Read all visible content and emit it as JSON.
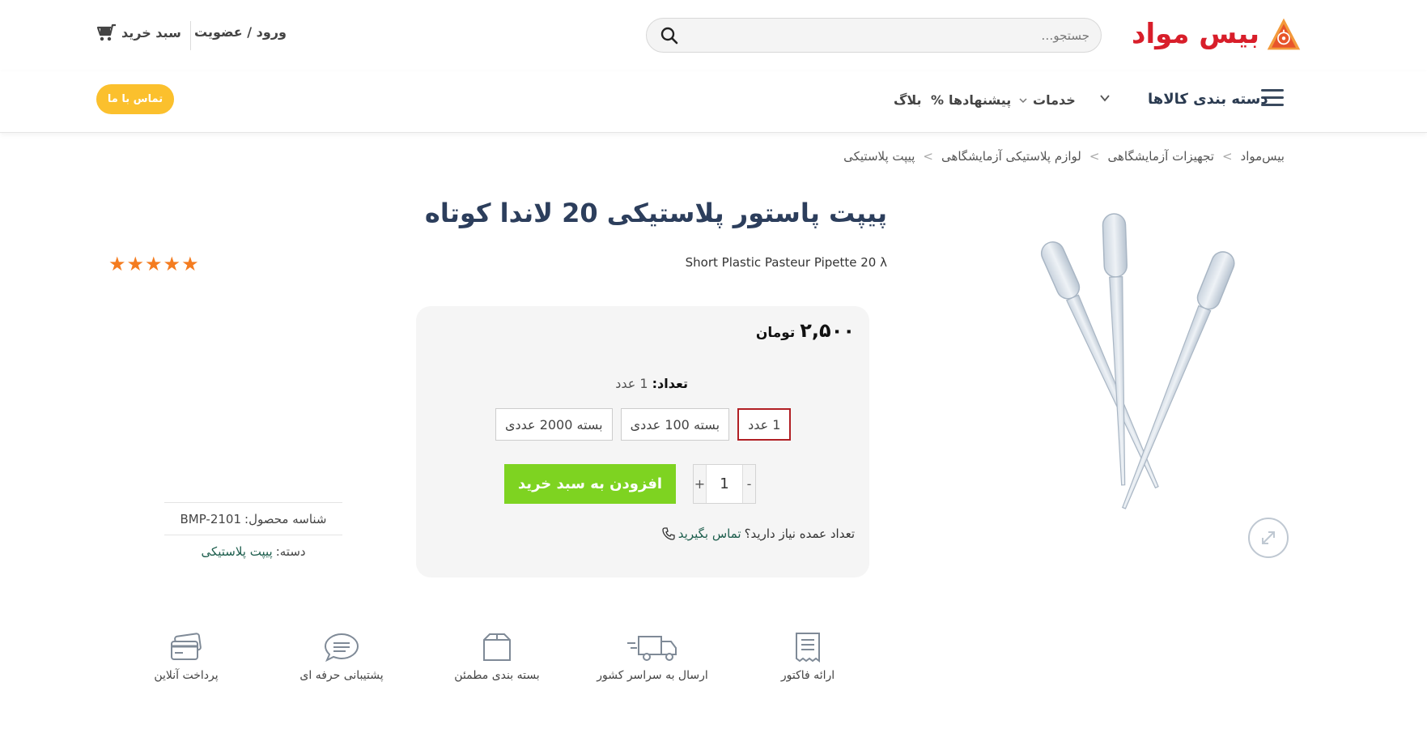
{
  "header": {
    "logo_text": "بیس مواد",
    "search": {
      "placeholder": "جستجو…"
    },
    "account_label": "ورود / عضویت",
    "cart_label": "سبد خرید"
  },
  "nav": {
    "categories_label": "دسته بندی کالاها",
    "items": [
      {
        "label": "خدمات",
        "has_dropdown": true
      },
      {
        "label": "پیشنهادها",
        "icon": "%"
      },
      {
        "label": "بلاگ"
      }
    ],
    "contact_button": "تماس با ما"
  },
  "breadcrumb": [
    "بیس‌مواد",
    "تجهیزات آزمایشگاهی",
    "لوازم پلاستیکی آزمایشگاهی",
    "پیپت پلاستیکی"
  ],
  "breadcrumb_separator": ">",
  "product": {
    "title": "پیپت پاستور پلاستیکی 20 لاندا کوتاه",
    "subtitle": "Short Plastic Pasteur Pipette 20 λ",
    "rating": 5,
    "rating_stars": 5,
    "price_value": "۲,۵۰۰",
    "price_unit": "تومان",
    "quantity_label": "تعداد:",
    "quantity_selected": "1 عدد",
    "variants": [
      {
        "label": "1 عدد",
        "selected": true
      },
      {
        "label": "بسته 100 عددی",
        "selected": false
      },
      {
        "label": "بسته 2000 عددی",
        "selected": false
      }
    ],
    "qty_minus": "-",
    "qty_plus": "+",
    "qty_value": "1",
    "add_to_cart": "افزودن به سبد خرید",
    "bulk_question": "تعداد عمده نیاز دارید؟",
    "bulk_link": "تماس بگیرید",
    "meta": {
      "sku_label": "شناسه محصول:",
      "sku_value": "BMP-2101",
      "category_label": "دسته:",
      "category_value": "پیپت پلاستیکی"
    }
  },
  "features": [
    {
      "label": "ارائه فاکتور",
      "icon": "invoice-icon"
    },
    {
      "label": "ارسال به سراسر کشور",
      "icon": "truck-icon"
    },
    {
      "label": "بسته بندی مطمئن",
      "icon": "box-icon"
    },
    {
      "label": "پشتیبانی حرفه ای",
      "icon": "chat-icon"
    },
    {
      "label": "پرداخت آنلاین",
      "icon": "card-icon"
    }
  ],
  "colors": {
    "brand_red": "#d81e2a",
    "title_navy": "#2c3e5c",
    "add_to_cart_green": "#7ed321",
    "contact_yellow": "#fbc02d",
    "star_orange": "#f47c20",
    "selected_variant_border": "#b11f24",
    "link_green": "#1c5d4c"
  }
}
